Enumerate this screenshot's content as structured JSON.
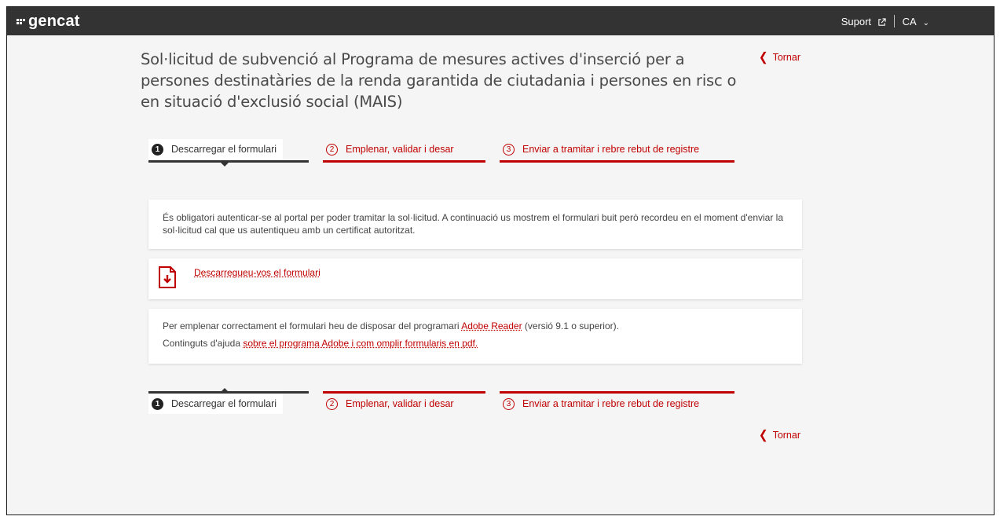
{
  "header": {
    "logo_text": "gencat",
    "support_label": "Suport",
    "language_label": "CA"
  },
  "page": {
    "title": "Sol·licitud de subvenció al Programa de mesures actives d'inserció per a persones destinatàries de la renda garantida de ciutadania i persones en risc o en situació d'exclusió social (MAIS)",
    "back_label": "Tornar"
  },
  "steps": [
    {
      "number": "1",
      "label": "Descarregar el formulari",
      "state": "active"
    },
    {
      "number": "2",
      "label": "Emplenar, validar i desar",
      "state": "todo"
    },
    {
      "number": "3",
      "label": "Enviar a tramitar i rebre rebut de registre",
      "state": "todo"
    }
  ],
  "notice": {
    "text": "És obligatori autenticar-se al portal per poder tramitar la sol·licitud. A continuació us mostrem el formulari buit però recordeu en el moment d'enviar la sol·licitud cal que us autentiqueu amb un certificat autoritzat."
  },
  "download": {
    "link_label": "Descarregueu-vos el formulari",
    "icon": "pdf-download-icon"
  },
  "help": {
    "line1_prefix": "Per emplenar correctament el formulari heu de disposar del programari ",
    "line1_link": "Adobe Reader",
    "line1_suffix": " (versió 9.1 o superior).",
    "line2_prefix": "Continguts d'ajuda ",
    "line2_link": "sobre el programa Adobe i com omplir formularis en pdf."
  },
  "colors": {
    "accent": "#c00000",
    "topbar": "#333333",
    "background": "#f5f5f5"
  }
}
